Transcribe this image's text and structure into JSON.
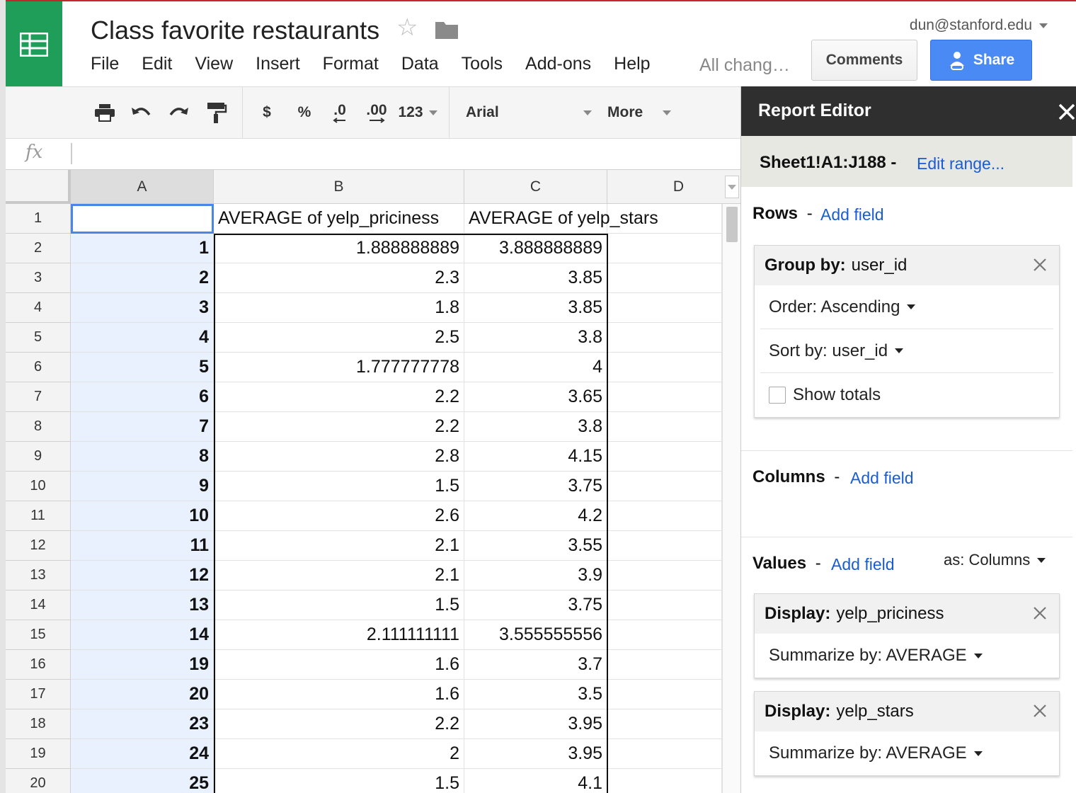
{
  "header": {
    "title": "Class favorite restaurants",
    "user_email": "dun@stanford.edu",
    "save_status": "All chang…",
    "comments_label": "Comments",
    "share_label": "Share",
    "menu": [
      "File",
      "Edit",
      "View",
      "Insert",
      "Format",
      "Data",
      "Tools",
      "Add-ons",
      "Help"
    ]
  },
  "toolbar": {
    "currency": "$",
    "percent": "%",
    "decrease_decimal": ".0",
    "increase_decimal": ".00",
    "more_formats": "123",
    "font": "Arial",
    "more": "More"
  },
  "formula_bar": {
    "fx": "fx",
    "value": ""
  },
  "grid": {
    "columns": [
      "A",
      "B",
      "C",
      "D"
    ],
    "rows": [
      {
        "n": "1",
        "a": "",
        "b": "AVERAGE of yelp_priciness",
        "c": "AVERAGE of yelp_stars"
      },
      {
        "n": "2",
        "a": "1",
        "b": "1.888888889",
        "c": "3.888888889"
      },
      {
        "n": "3",
        "a": "2",
        "b": "2.3",
        "c": "3.85"
      },
      {
        "n": "4",
        "a": "3",
        "b": "1.8",
        "c": "3.85"
      },
      {
        "n": "5",
        "a": "4",
        "b": "2.5",
        "c": "3.8"
      },
      {
        "n": "6",
        "a": "5",
        "b": "1.777777778",
        "c": "4"
      },
      {
        "n": "7",
        "a": "6",
        "b": "2.2",
        "c": "3.65"
      },
      {
        "n": "8",
        "a": "7",
        "b": "2.2",
        "c": "3.8"
      },
      {
        "n": "9",
        "a": "8",
        "b": "2.8",
        "c": "4.15"
      },
      {
        "n": "10",
        "a": "9",
        "b": "1.5",
        "c": "3.75"
      },
      {
        "n": "11",
        "a": "10",
        "b": "2.6",
        "c": "4.2"
      },
      {
        "n": "12",
        "a": "11",
        "b": "2.1",
        "c": "3.55"
      },
      {
        "n": "13",
        "a": "12",
        "b": "2.1",
        "c": "3.9"
      },
      {
        "n": "14",
        "a": "13",
        "b": "1.5",
        "c": "3.75"
      },
      {
        "n": "15",
        "a": "14",
        "b": "2.111111111",
        "c": "3.555555556"
      },
      {
        "n": "16",
        "a": "19",
        "b": "1.6",
        "c": "3.7"
      },
      {
        "n": "17",
        "a": "20",
        "b": "1.6",
        "c": "3.5"
      },
      {
        "n": "18",
        "a": "23",
        "b": "2.2",
        "c": "3.95"
      },
      {
        "n": "19",
        "a": "24",
        "b": "2",
        "c": "3.95"
      },
      {
        "n": "20",
        "a": "25",
        "b": "1.5",
        "c": "4.1"
      }
    ]
  },
  "report_editor": {
    "title": "Report Editor",
    "range": "Sheet1!A1:J188 -",
    "edit_range": "Edit range...",
    "rows": {
      "title": "Rows",
      "sep": "-",
      "add_field": "Add field",
      "group_label": "Group by:",
      "group_field": "user_id",
      "order": "Order: Ascending",
      "sort": "Sort by: user_id",
      "show_totals": "Show totals"
    },
    "columns": {
      "title": "Columns",
      "sep": "-",
      "add_field": "Add field"
    },
    "values": {
      "title": "Values",
      "sep": "-",
      "add_field": "Add field",
      "as": "as: Columns",
      "items": [
        {
          "label": "Display:",
          "field": "yelp_priciness",
          "summarize": "Summarize by: AVERAGE"
        },
        {
          "label": "Display:",
          "field": "yelp_stars",
          "summarize": "Summarize by: AVERAGE"
        }
      ]
    }
  },
  "colors": {
    "logo_green": "#1e9e58",
    "share_blue": "#4a8af4",
    "link_blue": "#1a5bd6",
    "selection_blue": "#4a86e8",
    "editor_header": "#2f2f2f"
  }
}
